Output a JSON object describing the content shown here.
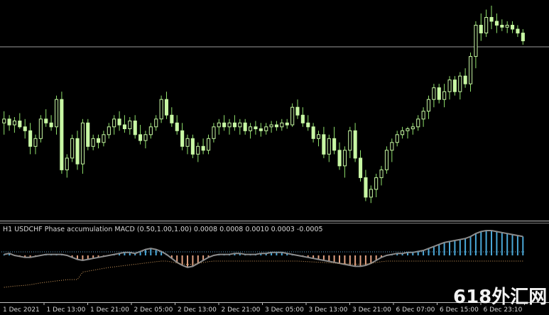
{
  "colors": {
    "background": "#000000",
    "bull_candle": "#c8f7a4",
    "bear_candle": "#8fe06b",
    "wick": "#8fe06b",
    "hline": "#9a9a9a",
    "separator": "#c0c0c0",
    "macd_line": "#8c8c8c",
    "hist_blue": "#4aa8d8",
    "hist_orange": "#e0a080",
    "dotted_blue": "#5aa0c8",
    "dotted_orange": "#d8a060",
    "axis_text": "#d8d8d8"
  },
  "indicator": {
    "label": "H1 USDCHF Phase accumulation MACD (0.50,1.00,1.00) 0.0008 0.0008 0.0010 0.0003 -0.0005"
  },
  "x_axis": {
    "ticks": [
      "1 Dec 2021",
      "1 Dec 13:00",
      "1 Dec 21:00",
      "2 Dec 05:00",
      "2 Dec 13:00",
      "2 Dec 21:00",
      "3 Dec 05:00",
      "3 Dec 13:00",
      "3 Dec 21:00",
      "6 Dec 07:00",
      "6 Dec 15:00",
      "6 Dec 23:10"
    ]
  },
  "watermark": {
    "text": "618外汇网"
  },
  "chart_data": {
    "type": "candlestick",
    "symbol": "USDCHF",
    "timeframe": "H1",
    "main_pane": {
      "candles_ohlc_relative": [
        [
          0.46,
          0.52,
          0.4,
          0.48
        ],
        [
          0.48,
          0.5,
          0.42,
          0.45
        ],
        [
          0.45,
          0.49,
          0.41,
          0.47
        ],
        [
          0.47,
          0.51,
          0.43,
          0.44
        ],
        [
          0.44,
          0.48,
          0.38,
          0.42
        ],
        [
          0.42,
          0.46,
          0.3,
          0.34
        ],
        [
          0.34,
          0.4,
          0.3,
          0.38
        ],
        [
          0.38,
          0.5,
          0.36,
          0.48
        ],
        [
          0.48,
          0.53,
          0.44,
          0.46
        ],
        [
          0.46,
          0.5,
          0.42,
          0.44
        ],
        [
          0.44,
          0.6,
          0.4,
          0.58
        ],
        [
          0.58,
          0.62,
          0.2,
          0.22
        ],
        [
          0.22,
          0.3,
          0.18,
          0.28
        ],
        [
          0.28,
          0.4,
          0.26,
          0.38
        ],
        [
          0.38,
          0.42,
          0.22,
          0.25
        ],
        [
          0.25,
          0.48,
          0.2,
          0.46
        ],
        [
          0.46,
          0.48,
          0.32,
          0.34
        ],
        [
          0.34,
          0.4,
          0.32,
          0.38
        ],
        [
          0.38,
          0.4,
          0.33,
          0.36
        ],
        [
          0.36,
          0.42,
          0.34,
          0.4
        ],
        [
          0.4,
          0.46,
          0.38,
          0.44
        ],
        [
          0.44,
          0.5,
          0.4,
          0.48
        ],
        [
          0.48,
          0.52,
          0.42,
          0.45
        ],
        [
          0.45,
          0.5,
          0.41,
          0.43
        ],
        [
          0.43,
          0.49,
          0.4,
          0.47
        ],
        [
          0.47,
          0.5,
          0.38,
          0.4
        ],
        [
          0.4,
          0.45,
          0.35,
          0.37
        ],
        [
          0.37,
          0.42,
          0.33,
          0.4
        ],
        [
          0.4,
          0.46,
          0.38,
          0.44
        ],
        [
          0.44,
          0.5,
          0.42,
          0.48
        ],
        [
          0.48,
          0.6,
          0.46,
          0.58
        ],
        [
          0.58,
          0.62,
          0.48,
          0.5
        ],
        [
          0.5,
          0.54,
          0.44,
          0.46
        ],
        [
          0.46,
          0.5,
          0.4,
          0.42
        ],
        [
          0.42,
          0.46,
          0.32,
          0.34
        ],
        [
          0.34,
          0.4,
          0.3,
          0.38
        ],
        [
          0.38,
          0.4,
          0.28,
          0.3
        ],
        [
          0.3,
          0.36,
          0.26,
          0.34
        ],
        [
          0.34,
          0.38,
          0.3,
          0.32
        ],
        [
          0.32,
          0.4,
          0.3,
          0.38
        ],
        [
          0.38,
          0.46,
          0.36,
          0.44
        ],
        [
          0.44,
          0.48,
          0.4,
          0.46
        ],
        [
          0.46,
          0.5,
          0.42,
          0.44
        ],
        [
          0.44,
          0.48,
          0.4,
          0.46
        ],
        [
          0.46,
          0.5,
          0.42,
          0.44
        ],
        [
          0.44,
          0.48,
          0.4,
          0.46
        ],
        [
          0.46,
          0.48,
          0.4,
          0.42
        ],
        [
          0.42,
          0.46,
          0.38,
          0.44
        ],
        [
          0.44,
          0.47,
          0.4,
          0.43
        ],
        [
          0.43,
          0.46,
          0.39,
          0.42
        ],
        [
          0.42,
          0.46,
          0.4,
          0.44
        ],
        [
          0.44,
          0.47,
          0.41,
          0.45
        ],
        [
          0.45,
          0.47,
          0.42,
          0.44
        ],
        [
          0.44,
          0.48,
          0.42,
          0.46
        ],
        [
          0.46,
          0.48,
          0.43,
          0.45
        ],
        [
          0.45,
          0.56,
          0.44,
          0.54
        ],
        [
          0.54,
          0.58,
          0.48,
          0.5
        ],
        [
          0.5,
          0.54,
          0.44,
          0.46
        ],
        [
          0.46,
          0.5,
          0.42,
          0.44
        ],
        [
          0.44,
          0.46,
          0.36,
          0.38
        ],
        [
          0.38,
          0.42,
          0.34,
          0.4
        ],
        [
          0.4,
          0.44,
          0.28,
          0.3
        ],
        [
          0.3,
          0.4,
          0.26,
          0.38
        ],
        [
          0.38,
          0.44,
          0.3,
          0.32
        ],
        [
          0.32,
          0.36,
          0.22,
          0.24
        ],
        [
          0.24,
          0.34,
          0.18,
          0.32
        ],
        [
          0.32,
          0.44,
          0.28,
          0.42
        ],
        [
          0.42,
          0.46,
          0.26,
          0.28
        ],
        [
          0.28,
          0.32,
          0.16,
          0.18
        ],
        [
          0.18,
          0.22,
          0.06,
          0.08
        ],
        [
          0.08,
          0.14,
          0.05,
          0.12
        ],
        [
          0.12,
          0.2,
          0.08,
          0.18
        ],
        [
          0.18,
          0.24,
          0.14,
          0.22
        ],
        [
          0.22,
          0.34,
          0.2,
          0.32
        ],
        [
          0.32,
          0.38,
          0.26,
          0.36
        ],
        [
          0.36,
          0.42,
          0.34,
          0.4
        ],
        [
          0.4,
          0.44,
          0.38,
          0.42
        ],
        [
          0.42,
          0.44,
          0.38,
          0.43
        ],
        [
          0.43,
          0.46,
          0.4,
          0.44
        ],
        [
          0.44,
          0.5,
          0.42,
          0.48
        ],
        [
          0.48,
          0.54,
          0.44,
          0.52
        ],
        [
          0.52,
          0.6,
          0.48,
          0.58
        ],
        [
          0.58,
          0.66,
          0.54,
          0.64
        ],
        [
          0.64,
          0.66,
          0.56,
          0.58
        ],
        [
          0.58,
          0.66,
          0.54,
          0.62
        ],
        [
          0.62,
          0.7,
          0.58,
          0.68
        ],
        [
          0.68,
          0.7,
          0.6,
          0.62
        ],
        [
          0.62,
          0.72,
          0.58,
          0.7
        ],
        [
          0.7,
          0.74,
          0.64,
          0.66
        ],
        [
          0.66,
          0.82,
          0.62,
          0.8
        ],
        [
          0.8,
          0.98,
          0.74,
          0.96
        ],
        [
          0.96,
          1.02,
          0.88,
          0.92
        ],
        [
          0.92,
          1.04,
          0.9,
          1.0
        ],
        [
          1.0,
          1.06,
          0.94,
          0.98
        ],
        [
          0.98,
          1.02,
          0.92,
          0.96
        ],
        [
          0.96,
          0.99,
          0.93,
          0.95
        ],
        [
          0.95,
          0.98,
          0.92,
          0.96
        ],
        [
          0.96,
          0.98,
          0.92,
          0.94
        ],
        [
          0.94,
          0.96,
          0.9,
          0.92
        ],
        [
          0.92,
          0.94,
          0.86,
          0.88
        ]
      ],
      "horizontal_line_relative_level": 0.93
    },
    "sub_pane": {
      "type": "histogram_with_line",
      "histogram": [
        0.1,
        0.2,
        0.0,
        -0.1,
        -0.2,
        -0.2,
        -0.1,
        0.0,
        0.1,
        0.1,
        0.1,
        0.1,
        0.0,
        -0.2,
        -0.4,
        -0.5,
        -0.4,
        -0.3,
        -0.2,
        -0.1,
        0.0,
        0.1,
        0.2,
        0.3,
        0.3,
        0.2,
        0.4,
        0.6,
        0.7,
        0.6,
        0.4,
        0.1,
        -0.3,
        -0.7,
        -1.0,
        -1.2,
        -1.1,
        -0.8,
        -0.5,
        -0.2,
        0.0,
        0.1,
        0.1,
        0.1,
        0.2,
        0.2,
        0.1,
        0.1,
        0.1,
        0.2,
        0.2,
        0.3,
        0.3,
        0.3,
        0.2,
        0.1,
        0.0,
        -0.1,
        -0.2,
        -0.3,
        -0.4,
        -0.5,
        -0.6,
        -0.7,
        -0.8,
        -0.9,
        -1.0,
        -1.1,
        -1.1,
        -1.0,
        -0.8,
        -0.5,
        -0.2,
        0.0,
        0.1,
        0.2,
        0.2,
        0.3,
        0.3,
        0.4,
        0.5,
        0.7,
        0.9,
        1.1,
        1.3,
        1.4,
        1.5,
        1.6,
        1.7,
        1.9,
        2.2,
        2.4,
        2.5,
        2.5,
        2.4,
        2.3,
        2.2,
        2.1,
        2.0,
        1.9
      ]
    }
  }
}
